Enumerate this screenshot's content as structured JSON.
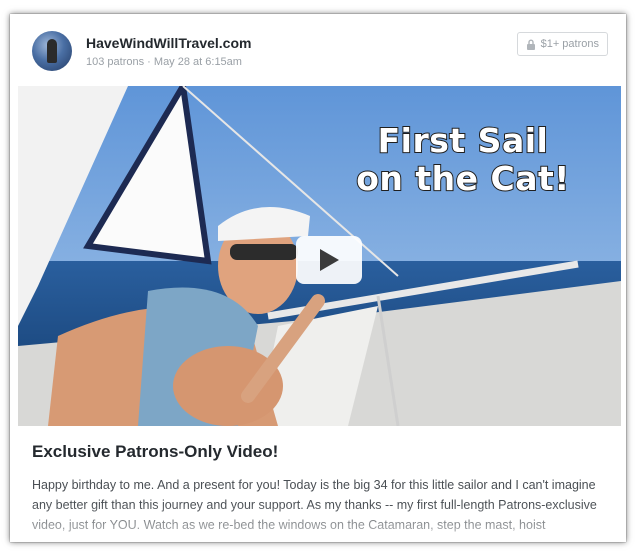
{
  "post": {
    "creator_name": "HaveWindWillTravel.com",
    "patron_count": "103 patrons",
    "separator": "·",
    "timestamp": "May 28 at 6:15am",
    "tier_label": "$1+ patrons",
    "video": {
      "caption_line1": "First Sail",
      "caption_line2": "on the Cat!",
      "play_icon": "play-icon"
    },
    "title": "Exclusive Patrons-Only Video!",
    "body": "Happy birthday to me.  And a present for you!  Today is the big 34 for this little sailor and I can't imagine any better gift than this journey and your support.  As my thanks -- my first full-length Patrons-exclusive video, just for YOU.  Watch as we re-bed the windows on the Catamaran, step the mast, hoist"
  },
  "colors": {
    "title": "#24292e",
    "muted": "#9aa0a6",
    "sky": "#6f9fd8",
    "sea": "#1d4f8c"
  }
}
